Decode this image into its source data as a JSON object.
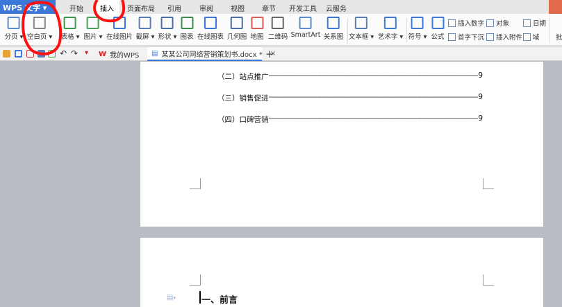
{
  "app": {
    "title": "WPS 文字"
  },
  "tabs": [
    "开始",
    "插入",
    "页面布局",
    "引用",
    "审阅",
    "视图",
    "章节",
    "开发工具",
    "云服务"
  ],
  "active_tab": "插入",
  "ribbon": {
    "large": [
      "分页",
      "空白页",
      "表格",
      "图片",
      "在线图片",
      "截屏",
      "形状",
      "图表",
      "在线图表",
      "几何图",
      "地图",
      "二维码",
      "SmartArt",
      "关系图",
      "文本框",
      "艺术字",
      "符号",
      "公式"
    ],
    "small": [
      "插入数字",
      "首字下沉",
      "对象",
      "插入附件",
      "日期",
      "域"
    ],
    "cut": "批"
  },
  "doc_tabs": [
    {
      "label": "我的WPS"
    },
    {
      "label": "某某公司网络营销策划书.docx *"
    }
  ],
  "document": {
    "toc": [
      {
        "text": "（二）站点推广",
        "page": "9"
      },
      {
        "text": "（三）销售促进",
        "page": "9"
      },
      {
        "text": "（四）口碑营销",
        "page": "9"
      }
    ],
    "heading": "一、前言"
  },
  "colors": {
    "wps_blue": "#3c78d8",
    "annotation_red": "#ff1010",
    "canvas": "#b9bcc3"
  }
}
